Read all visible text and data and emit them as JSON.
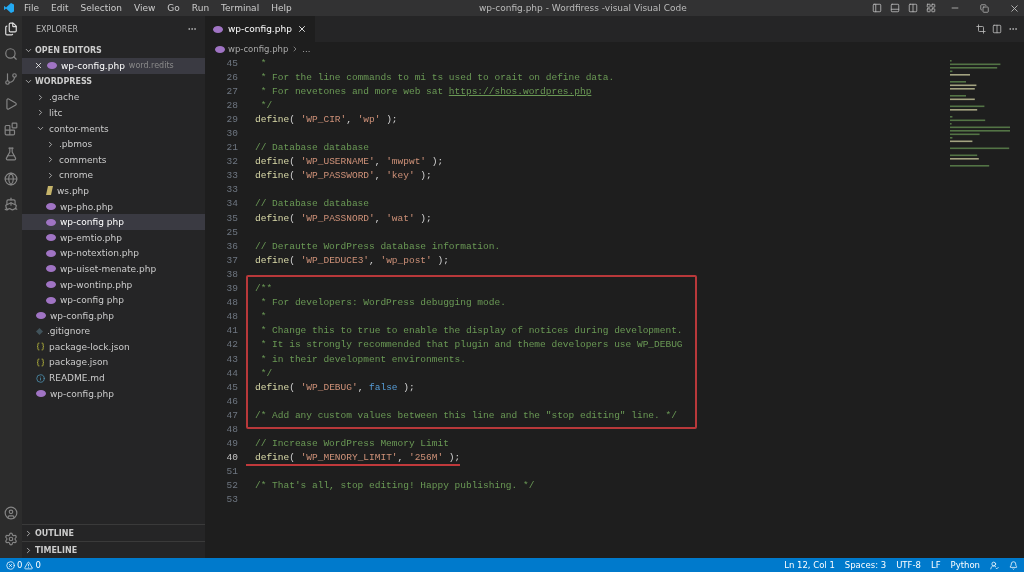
{
  "window": {
    "title": "wp-config.php - Wordfiress -visual Visual Code",
    "menu": [
      "File",
      "Edit",
      "Selection",
      "View",
      "Go",
      "Run",
      "Terminal",
      "Help"
    ]
  },
  "sidebar": {
    "header": "EXPLORER",
    "open_editors": {
      "title": "OPEN EDITORS",
      "expanded": true,
      "items": [
        {
          "name": "wp-config.php",
          "detail": "word.redits",
          "kind": "php",
          "selected": true
        }
      ]
    },
    "project": {
      "title": "WORDPRESS",
      "expanded": true,
      "tree": [
        {
          "name": ".gache",
          "kind": "folder",
          "expanded": false,
          "selected": false
        },
        {
          "name": "litc",
          "kind": "folder",
          "expanded": false,
          "selected": false
        },
        {
          "name": "contor-ments",
          "kind": "folder",
          "expanded": true,
          "selected": false,
          "children": [
            {
              "name": ".pbmos",
              "kind": "folder",
              "expanded": false,
              "selected": false
            },
            {
              "name": "comments",
              "kind": "folder",
              "expanded": false,
              "selected": false
            },
            {
              "name": "cnrome",
              "kind": "folder",
              "expanded": false,
              "selected": false
            },
            {
              "name": "ws.php",
              "kind": "script",
              "selected": false
            },
            {
              "name": "wp-pho.php",
              "kind": "php",
              "selected": false
            },
            {
              "name": "wp-config php",
              "kind": "php",
              "selected": true
            },
            {
              "name": "wp-emtio.php",
              "kind": "php",
              "selected": false
            },
            {
              "name": "wp-notextion.php",
              "kind": "php",
              "selected": false
            },
            {
              "name": "wp-uiset-menate.php",
              "kind": "php",
              "selected": false
            },
            {
              "name": "wp-wontinp.php",
              "kind": "php",
              "selected": false
            },
            {
              "name": "wp-config php",
              "kind": "php",
              "selected": false
            }
          ]
        },
        {
          "name": "wp-config.php",
          "kind": "php",
          "selected": false
        },
        {
          "name": ".gitignore",
          "kind": "git",
          "selected": false
        },
        {
          "name": "package-lock.json",
          "kind": "json",
          "selected": false
        },
        {
          "name": "package.json",
          "kind": "json",
          "selected": false
        },
        {
          "name": "README.md",
          "kind": "info",
          "selected": false
        },
        {
          "name": "wp-config.php",
          "kind": "php",
          "selected": false
        }
      ]
    },
    "bottom_sections": [
      {
        "title": "OUTLINE",
        "expanded": false
      },
      {
        "title": "TIMELINE",
        "expanded": false
      }
    ]
  },
  "editor": {
    "tabs": [
      {
        "label": "wp-config.php",
        "selected": true
      }
    ],
    "breadcrumb": [
      "wp-config.php",
      "..."
    ],
    "blocks": [
      {
        "kind": "plain",
        "lines": [
          {
            "n": "45",
            "current": false,
            "tokens": [
              {
                "kind": "comment",
                "text": " *"
              }
            ]
          },
          {
            "n": "26",
            "current": false,
            "tokens": [
              {
                "kind": "comment",
                "text": " * For the line commands to mi ts used to orait on define data."
              }
            ]
          },
          {
            "n": "27",
            "current": false,
            "tokens": [
              {
                "kind": "comment",
                "text": " * For nevetones and more web sat "
              },
              {
                "kind": "link",
                "text": "https://shos.wordpres.php"
              }
            ]
          },
          {
            "n": "28",
            "current": false,
            "tokens": [
              {
                "kind": "comment",
                "text": " */"
              }
            ]
          },
          {
            "n": "29",
            "current": false,
            "tokens": [
              {
                "kind": "function",
                "text": "define"
              },
              {
                "kind": "punct",
                "text": "( "
              },
              {
                "kind": "string",
                "text": "'WP_CIR'"
              },
              {
                "kind": "punct",
                "text": ", "
              },
              {
                "kind": "string",
                "text": "'wp'"
              },
              {
                "kind": "punct",
                "text": " );"
              }
            ]
          },
          {
            "n": "30",
            "current": false
          },
          {
            "n": "21",
            "current": false,
            "tokens": [
              {
                "kind": "comment",
                "text": "// Database database"
              }
            ]
          },
          {
            "n": "32",
            "current": false,
            "tokens": [
              {
                "kind": "function",
                "text": "define"
              },
              {
                "kind": "punct",
                "text": "( "
              },
              {
                "kind": "string",
                "text": "'WP_USERNAME'"
              },
              {
                "kind": "punct",
                "text": ", "
              },
              {
                "kind": "string",
                "text": "'mwpwt'"
              },
              {
                "kind": "punct",
                "text": " );"
              }
            ]
          },
          {
            "n": "33",
            "current": false,
            "tokens": [
              {
                "kind": "function",
                "text": "define"
              },
              {
                "kind": "punct",
                "text": "( "
              },
              {
                "kind": "string",
                "text": "'WP_PASSWORD'"
              },
              {
                "kind": "punct",
                "text": ", "
              },
              {
                "kind": "string",
                "text": "'key'"
              },
              {
                "kind": "punct",
                "text": " );"
              }
            ]
          },
          {
            "n": "33",
            "current": false
          },
          {
            "n": "34",
            "current": false,
            "tokens": [
              {
                "kind": "comment",
                "text": "// Database database"
              }
            ]
          },
          {
            "n": "35",
            "current": false,
            "tokens": [
              {
                "kind": "function",
                "text": "define"
              },
              {
                "kind": "punct",
                "text": "( "
              },
              {
                "kind": "string",
                "text": "'WP_PASSNORD'"
              },
              {
                "kind": "punct",
                "text": ", "
              },
              {
                "kind": "string",
                "text": "'wat'"
              },
              {
                "kind": "punct",
                "text": " );"
              }
            ]
          },
          {
            "n": "25",
            "current": false
          },
          {
            "n": "36",
            "current": false,
            "tokens": [
              {
                "kind": "comment",
                "text": "// Derautte WordPress database information."
              }
            ]
          },
          {
            "n": "37",
            "current": false,
            "tokens": [
              {
                "kind": "function",
                "text": "define"
              },
              {
                "kind": "punct",
                "text": "( "
              },
              {
                "kind": "string",
                "text": "'WP_DEDUCE3'"
              },
              {
                "kind": "punct",
                "text": ", "
              },
              {
                "kind": "string",
                "text": "'wp_post'"
              },
              {
                "kind": "punct",
                "text": " );"
              }
            ]
          },
          {
            "n": "38",
            "current": false
          }
        ]
      },
      {
        "kind": "boxed",
        "lines": [
          {
            "n": "39",
            "current": false,
            "tokens": [
              {
                "kind": "comment",
                "text": "/**"
              }
            ]
          },
          {
            "n": "48",
            "current": false,
            "tokens": [
              {
                "kind": "comment",
                "text": " * For developers: WordPress debugging mode."
              }
            ]
          },
          {
            "n": "48",
            "current": false,
            "tokens": [
              {
                "kind": "comment",
                "text": " *"
              }
            ]
          },
          {
            "n": "41",
            "current": false,
            "tokens": [
              {
                "kind": "comment",
                "text": " * Change this to true to enable the display of notices during development."
              }
            ]
          },
          {
            "n": "42",
            "current": false,
            "tokens": [
              {
                "kind": "comment",
                "text": " * It is strongly recommended that plugin and theme developers use WP_DEBUG"
              }
            ]
          },
          {
            "n": "43",
            "current": false,
            "tokens": [
              {
                "kind": "comment",
                "text": " * in their development environments."
              }
            ]
          },
          {
            "n": "44",
            "current": false,
            "tokens": [
              {
                "kind": "comment",
                "text": " */"
              }
            ]
          },
          {
            "n": "45",
            "current": false,
            "tokens": [
              {
                "kind": "function",
                "text": "define"
              },
              {
                "kind": "punct",
                "text": "( "
              },
              {
                "kind": "string",
                "text": "'WP_DEBUG'"
              },
              {
                "kind": "punct",
                "text": ", "
              },
              {
                "kind": "bool",
                "text": "false"
              },
              {
                "kind": "punct",
                "text": " );"
              }
            ]
          },
          {
            "n": "46",
            "current": false
          },
          {
            "n": "47",
            "current": false,
            "tokens": [
              {
                "kind": "comment",
                "text": "/* Add any custom values between this line and the \"stop editing\" line. */"
              }
            ]
          }
        ]
      },
      {
        "kind": "plain",
        "lines": [
          {
            "n": "48",
            "current": false
          },
          {
            "n": "49",
            "current": false,
            "tokens": [
              {
                "kind": "comment",
                "text": "// Increase WordPress Memory Limit"
              }
            ]
          },
          {
            "n": "40",
            "current": true,
            "underlined": true,
            "tokens": [
              {
                "kind": "function",
                "text": "define"
              },
              {
                "kind": "punct",
                "text": "( "
              },
              {
                "kind": "string",
                "text": "'WP_MENORY_LIMIT'"
              },
              {
                "kind": "punct",
                "text": ", "
              },
              {
                "kind": "string",
                "text": "'256M'"
              },
              {
                "kind": "punct",
                "text": " );"
              }
            ]
          },
          {
            "n": "51",
            "current": false
          },
          {
            "n": "52",
            "current": false,
            "tokens": [
              {
                "kind": "comment",
                "text": "/* That's all, stop editing! Happy publishing. */"
              }
            ]
          },
          {
            "n": "53",
            "current": false
          }
        ]
      }
    ]
  },
  "status_bar": {
    "errors": "0",
    "warnings": "0",
    "items": [
      "Ln 12, Col 1",
      "Spaces: 3",
      "UTF-8",
      "LF",
      "Python"
    ]
  }
}
